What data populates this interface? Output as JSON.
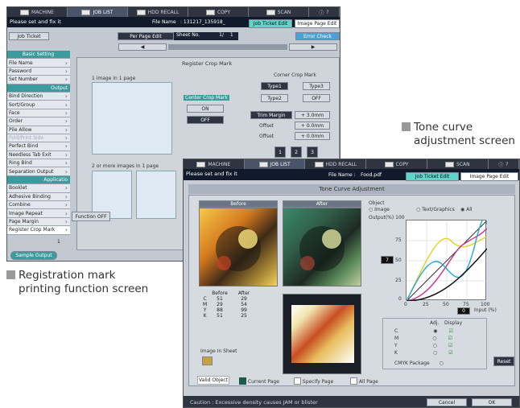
{
  "captions": {
    "tone": [
      "Tone curve",
      "adjustment screen"
    ],
    "reg": [
      "Registration mark",
      "printing function screen"
    ]
  },
  "tabs": [
    "MACHINE",
    "JOB LIST",
    "HDD RECALL",
    "COPY",
    "SCAN"
  ],
  "s1": {
    "message": "Please set and fix it",
    "file_label": "File Name",
    "file_name": ": 131217_135918_",
    "job_ticket_edit": "Job Ticket Edit",
    "image_page_edit": "Image Page Edit",
    "job_ticket": "Job Ticket",
    "per_page_edit": "Per Page Edit",
    "sheet_no": "Sheet No.",
    "sheet_val": "1/",
    "sheet_total": "1",
    "error_check": "Error Check",
    "basic": "Basic Setting",
    "output": "Output",
    "application": "Applicatio",
    "menu_basic": [
      "File Name",
      "Password",
      "Set Number"
    ],
    "menu_output": [
      "Bind Direction",
      "Sort/Group",
      "Face",
      "Order",
      "Pile Allow",
      "Fold/Print Side",
      "Perfect Bind",
      "Needless Tab Exit",
      "Ring Bind",
      "Separation Output"
    ],
    "menu_app": [
      "Booklet",
      "Adhesive Binding",
      "Combine",
      "Image Repeat",
      "Page Margin",
      "Register Crop Mark"
    ],
    "title": "Register Crop Mark",
    "one_image": "1 image in 1 page",
    "two_images": "2 or more images in 1 page",
    "center_crop": "Center Crop Mark",
    "on": "ON",
    "off": "OFF",
    "corner_crop": "Corner Crop Mark",
    "type1": "Type1",
    "type2": "Type2",
    "type3": "Type3",
    "off2": "OFF",
    "trim_margin": "Trim Margin",
    "trim_val": "+ 3.0mm",
    "offset": "Offset",
    "offset_val1": "+ 0.0mm",
    "offset_val2": "+ 0.0mm",
    "nums": [
      "1",
      "2",
      "3"
    ],
    "function_off": "Function OFF",
    "sample_output": "Sample Output",
    "page_num": "1"
  },
  "s2": {
    "message": "Please set and fix it",
    "file_label": "File Name :",
    "file_name": "Food.pdf",
    "job_ticket_edit": "Job Ticket Edit",
    "image_page_edit": "Image Page Edit",
    "title": "Tone Curve Adjustment",
    "before": "Before",
    "after": "After",
    "object": "Object",
    "obj_opts": [
      "Image",
      "Text/Graphics",
      "All"
    ],
    "output_label": "Output(%) 100",
    "y_ticks": [
      "75",
      "50",
      "25",
      "0"
    ],
    "x_ticks": [
      "0",
      "25",
      "50",
      "75",
      "100"
    ],
    "input_label": "Input (%)",
    "left_val": "7",
    "bottom_val": "0",
    "table": {
      "head": [
        "",
        "Before",
        "After"
      ],
      "rows": [
        [
          "C",
          "51",
          "29"
        ],
        [
          "M",
          "29",
          "54"
        ],
        [
          "Y",
          "88",
          "99"
        ],
        [
          "K",
          "51",
          "25"
        ]
      ]
    },
    "adj_head": [
      "Adj.",
      "Display"
    ],
    "adj_rows": [
      "C",
      "M",
      "Y",
      "K"
    ],
    "cmyk": "CMYK Package",
    "reset": "Reset",
    "image_in_sheet": "Image In Sheet",
    "valid_object": "Valid Object",
    "current_page": "Current Page",
    "specify_page": "Specify Page",
    "all_page": "All Page",
    "caution": "Caution : Excessive density causes JAM or blister",
    "cancel": "Cancel",
    "ok": "OK"
  }
}
